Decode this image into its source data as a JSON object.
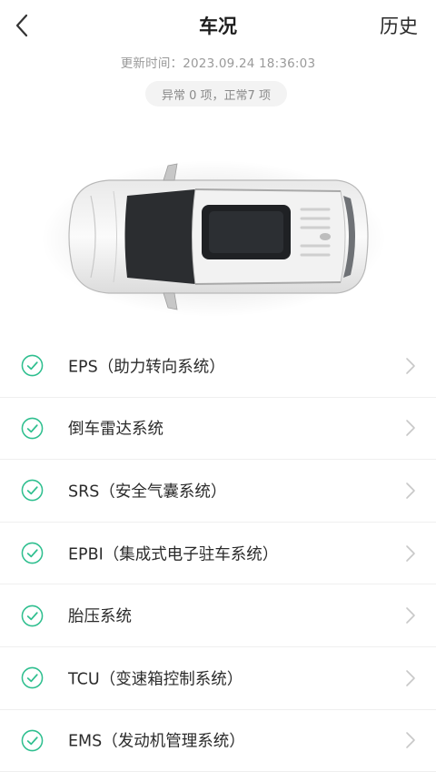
{
  "header": {
    "title": "车况",
    "history_label": "历史"
  },
  "update": {
    "text": "更新时间：2023.09.24 18:36:03"
  },
  "summary": {
    "text": "异常 0 项，正常7 项"
  },
  "colors": {
    "ok_green": "#2fbf8f",
    "chevron": "#c8c8c8",
    "divider": "#efefef"
  },
  "systems": [
    {
      "label": "EPS（助力转向系统）",
      "status": "normal",
      "icon": "check-circle-icon"
    },
    {
      "label": "倒车雷达系统",
      "status": "normal",
      "icon": "check-circle-icon"
    },
    {
      "label": "SRS（安全气囊系统）",
      "status": "normal",
      "icon": "check-circle-icon"
    },
    {
      "label": "EPBI（集成式电子驻车系统）",
      "status": "normal",
      "icon": "check-circle-icon"
    },
    {
      "label": "胎压系统",
      "status": "normal",
      "icon": "check-circle-icon"
    },
    {
      "label": "TCU（变速箱控制系统）",
      "status": "normal",
      "icon": "check-circle-icon"
    },
    {
      "label": "EMS（发动机管理系统）",
      "status": "normal",
      "icon": "check-circle-icon"
    }
  ]
}
